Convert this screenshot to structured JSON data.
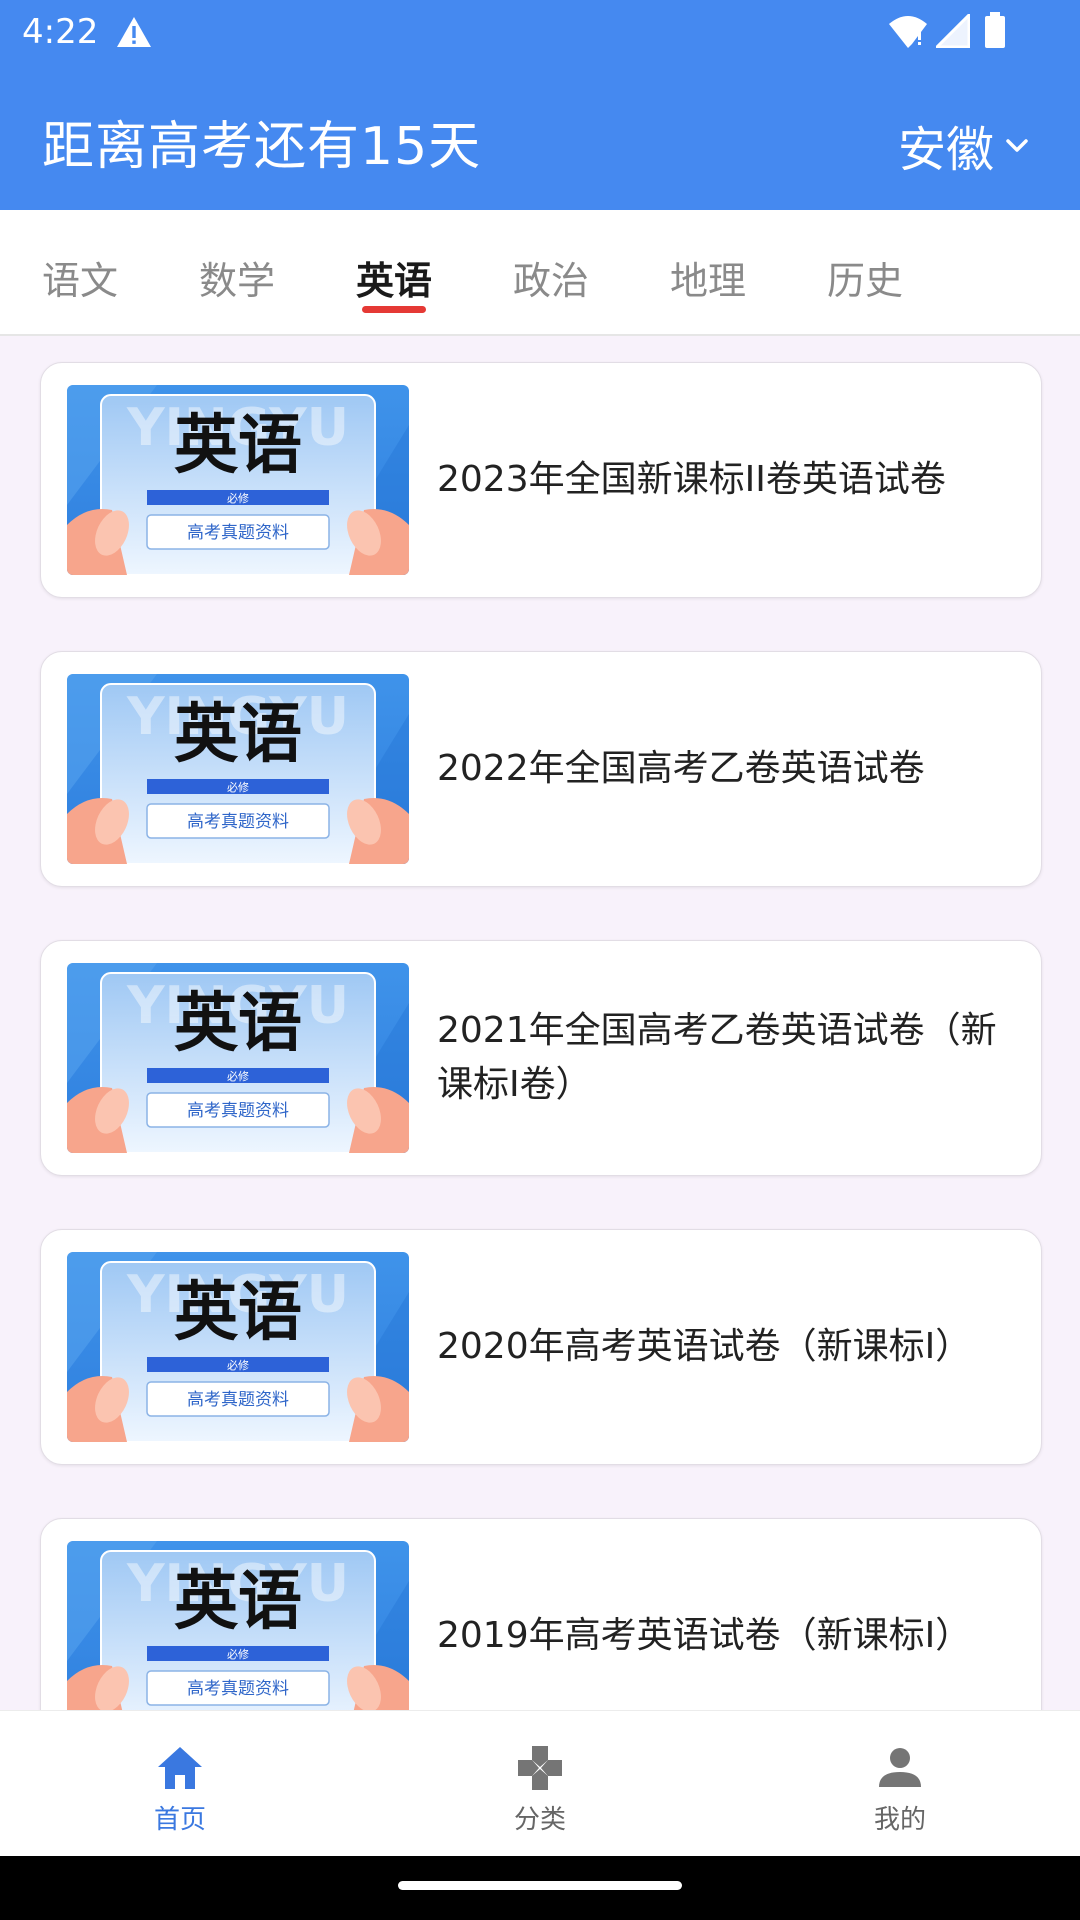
{
  "status": {
    "time": "4:22"
  },
  "header": {
    "countdown": "距离高考还有15天",
    "province": "安徽"
  },
  "tabs": [
    {
      "label": "语文",
      "active": false
    },
    {
      "label": "数学",
      "active": false
    },
    {
      "label": "英语",
      "active": true
    },
    {
      "label": "政治",
      "active": false
    },
    {
      "label": "地理",
      "active": false
    },
    {
      "label": "历史",
      "active": false
    }
  ],
  "thumb": {
    "bg_word": "YINGYU",
    "subject": "英语",
    "tag": "必修",
    "caption": "高考真题资料"
  },
  "items": [
    {
      "title": "2023年全国新课标II卷英语试卷"
    },
    {
      "title": "2022年全国高考乙卷英语试卷"
    },
    {
      "title": "2021年全国高考乙卷英语试卷（新课标I卷）"
    },
    {
      "title": "2020年高考英语试卷（新课标I）"
    },
    {
      "title": "2019年高考英语试卷（新课标I）"
    }
  ],
  "bottom_nav": [
    {
      "label": "首页",
      "icon": "home-icon",
      "active": true
    },
    {
      "label": "分类",
      "icon": "category-icon",
      "active": false
    },
    {
      "label": "我的",
      "icon": "person-icon",
      "active": false
    }
  ],
  "colors": {
    "primary": "#4589f0",
    "tab_indicator": "#e53935",
    "nav_active": "#3a78e0"
  }
}
